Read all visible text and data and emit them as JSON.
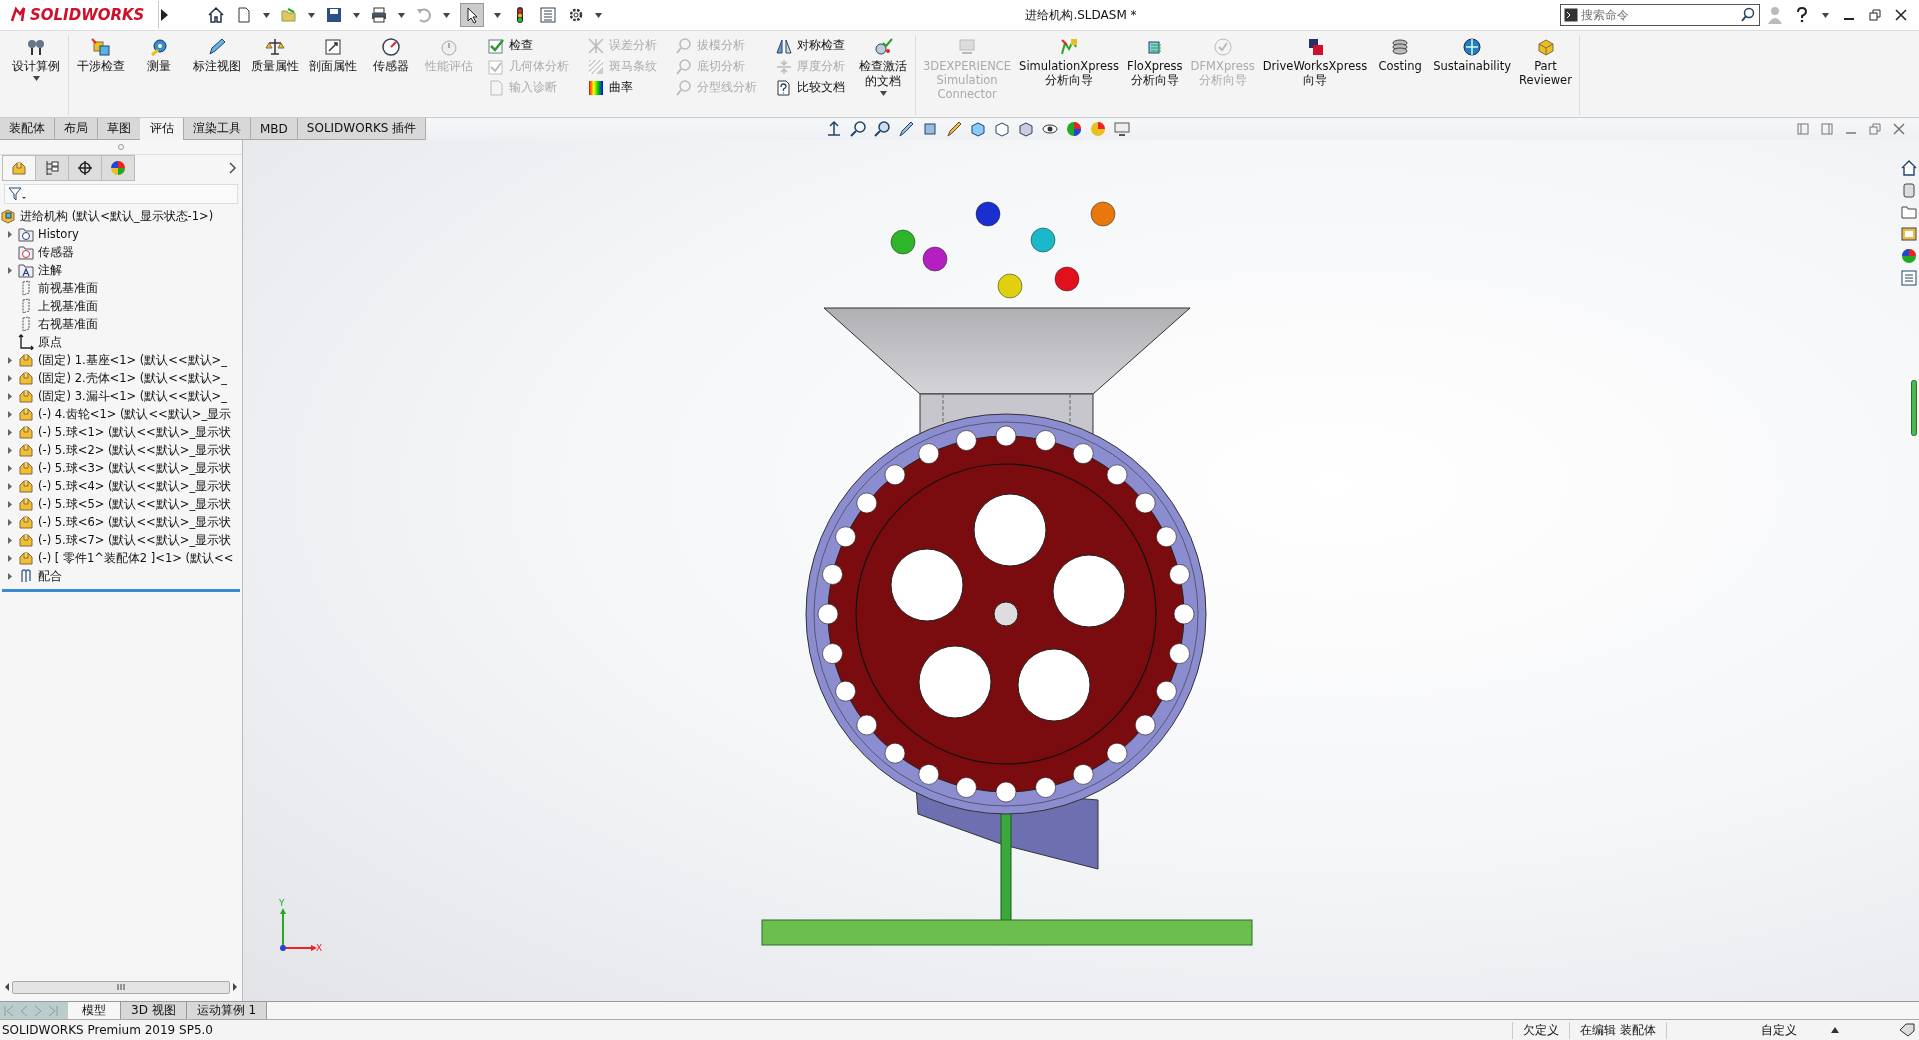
{
  "title_bar": {
    "logo": "SOLIDWORKS",
    "document_title": "进给机构.SLDASM *",
    "search": {
      "placeholder": "搜索命令"
    }
  },
  "ribbon": {
    "groups": [
      {
        "items": [
          {
            "kind": "large",
            "label": "设计算例",
            "disabled": false,
            "dropdown": true
          }
        ]
      },
      {
        "items": [
          {
            "kind": "large",
            "label": "干涉检查",
            "disabled": false,
            "dropdown": false
          },
          {
            "kind": "large",
            "label": "测量",
            "disabled": false,
            "dropdown": false
          },
          {
            "kind": "large",
            "label": "标注视图",
            "disabled": false,
            "dropdown": false
          },
          {
            "kind": "large",
            "label": "质量属性",
            "disabled": false,
            "dropdown": false
          },
          {
            "kind": "large",
            "label": "剖面属性",
            "disabled": false,
            "dropdown": false
          },
          {
            "kind": "large",
            "label": "传感器",
            "disabled": false,
            "dropdown": false
          },
          {
            "kind": "large",
            "label": "性能评估",
            "disabled": true,
            "dropdown": false
          },
          {
            "kind": "small",
            "label": "检查",
            "disabled": false,
            "dropdown": false
          },
          {
            "kind": "small",
            "label": "几何体分析",
            "disabled": true,
            "dropdown": false
          },
          {
            "kind": "small",
            "label": "输入诊断",
            "disabled": true,
            "dropdown": false
          },
          {
            "kind": "small",
            "label": "误差分析",
            "disabled": true,
            "dropdown": false
          },
          {
            "kind": "small",
            "label": "斑马条纹",
            "disabled": true,
            "dropdown": false
          },
          {
            "kind": "small",
            "label": "曲率",
            "disabled": false,
            "dropdown": false
          },
          {
            "kind": "small",
            "label": "拔模分析",
            "disabled": true,
            "dropdown": false
          },
          {
            "kind": "small",
            "label": "底切分析",
            "disabled": true,
            "dropdown": false
          },
          {
            "kind": "small",
            "label": "分型线分析",
            "disabled": true,
            "dropdown": false
          },
          {
            "kind": "small",
            "label": "对称检查",
            "disabled": false,
            "dropdown": false
          },
          {
            "kind": "small",
            "label": "厚度分析",
            "disabled": true,
            "dropdown": false
          },
          {
            "kind": "small",
            "label": "比较文档",
            "disabled": false,
            "dropdown": false
          },
          {
            "kind": "large",
            "label": "检查激活的文档",
            "disabled": false,
            "dropdown": true
          }
        ]
      },
      {
        "items": [
          {
            "kind": "large",
            "label": "3DEXPERIENCE Simulation Connector",
            "disabled": true,
            "dropdown": false
          },
          {
            "kind": "large",
            "label": "SimulationXpress 分析向导",
            "disabled": false,
            "dropdown": false
          },
          {
            "kind": "large",
            "label": "FloXpress 分析向导",
            "disabled": false,
            "dropdown": false
          },
          {
            "kind": "large",
            "label": "DFMXpress 分析向导",
            "disabled": true,
            "dropdown": false
          },
          {
            "kind": "large",
            "label": "DriveWorksXpress 向导",
            "disabled": false,
            "dropdown": false
          },
          {
            "kind": "large",
            "label": "Costing",
            "disabled": false,
            "dropdown": false
          },
          {
            "kind": "large",
            "label": "Sustainability",
            "disabled": false,
            "dropdown": false
          },
          {
            "kind": "large",
            "label": "Part Reviewer",
            "disabled": false,
            "dropdown": false
          }
        ]
      }
    ]
  },
  "command_tabs": [
    {
      "label": "装配体",
      "selected": false
    },
    {
      "label": "布局",
      "selected": false
    },
    {
      "label": "草图",
      "selected": false
    },
    {
      "label": "评估",
      "selected": true
    },
    {
      "label": "渲染工具",
      "selected": false
    },
    {
      "label": "MBD",
      "selected": false
    },
    {
      "label": "SOLIDWORKS 插件",
      "selected": false
    }
  ],
  "feature_manager": {
    "panel_tabs": [
      {
        "selected": true
      },
      {
        "selected": false
      },
      {
        "selected": false
      },
      {
        "selected": false
      }
    ],
    "tree": {
      "label": "进给机构  (默认<默认_显示状态-1>)",
      "children": [
        {
          "label": "History",
          "kind": "history",
          "expander": true
        },
        {
          "label": "传感器",
          "kind": "sensors",
          "expander": false
        },
        {
          "label": "注解",
          "kind": "annotations",
          "expander": true
        },
        {
          "label": "前视基准面",
          "kind": "plane",
          "expander": false
        },
        {
          "label": "上视基准面",
          "kind": "plane",
          "expander": false
        },
        {
          "label": "右视基准面",
          "kind": "plane",
          "expander": false
        },
        {
          "label": "原点",
          "kind": "origin",
          "expander": false
        },
        {
          "label": "(固定) 1.基座<1> (默认<<默认>_",
          "kind": "component",
          "expander": true
        },
        {
          "label": "(固定) 2.壳体<1> (默认<<默认>_",
          "kind": "component",
          "expander": true
        },
        {
          "label": "(固定) 3.漏斗<1> (默认<<默认>_",
          "kind": "component",
          "expander": true
        },
        {
          "label": "(-) 4.齿轮<1> (默认<<默认>_显示",
          "kind": "component",
          "expander": true
        },
        {
          "label": "(-) 5.球<1> (默认<<默认>_显示状",
          "kind": "component",
          "expander": true
        },
        {
          "label": "(-) 5.球<2> (默认<<默认>_显示状",
          "kind": "component",
          "expander": true
        },
        {
          "label": "(-) 5.球<3> (默认<<默认>_显示状",
          "kind": "component",
          "expander": true
        },
        {
          "label": "(-) 5.球<4> (默认<<默认>_显示状",
          "kind": "component",
          "expander": true
        },
        {
          "label": "(-) 5.球<5> (默认<<默认>_显示状",
          "kind": "component",
          "expander": true
        },
        {
          "label": "(-) 5.球<6> (默认<<默认>_显示状",
          "kind": "component",
          "expander": true
        },
        {
          "label": "(-) 5.球<7> (默认<<默认>_显示状",
          "kind": "component",
          "expander": true
        },
        {
          "label": "(-) [ 零件1^装配体2 ]<1> (默认<<",
          "kind": "component",
          "expander": true
        },
        {
          "label": "配合",
          "kind": "mates",
          "expander": true
        }
      ]
    }
  },
  "viewport": {
    "triad": {
      "y_label": "Y",
      "x_label": "X"
    },
    "balls": [
      {
        "color": "#1a2fd0"
      },
      {
        "color": "#e8780c"
      },
      {
        "color": "#2fb52a"
      },
      {
        "color": "#1ab8c8"
      },
      {
        "color": "#b51ec0"
      },
      {
        "color": "#e0101c"
      },
      {
        "color": "#e0d010"
      }
    ]
  },
  "bottom_tabs": [
    {
      "label": "模型",
      "selected": true
    },
    {
      "label": "3D 视图",
      "selected": false
    },
    {
      "label": "运动算例 1",
      "selected": false
    }
  ],
  "status_bar": {
    "product": "SOLIDWORKS Premium 2019 SP5.0",
    "fields": [
      "欠定义",
      "在编辑 装配体",
      "自定义"
    ]
  }
}
